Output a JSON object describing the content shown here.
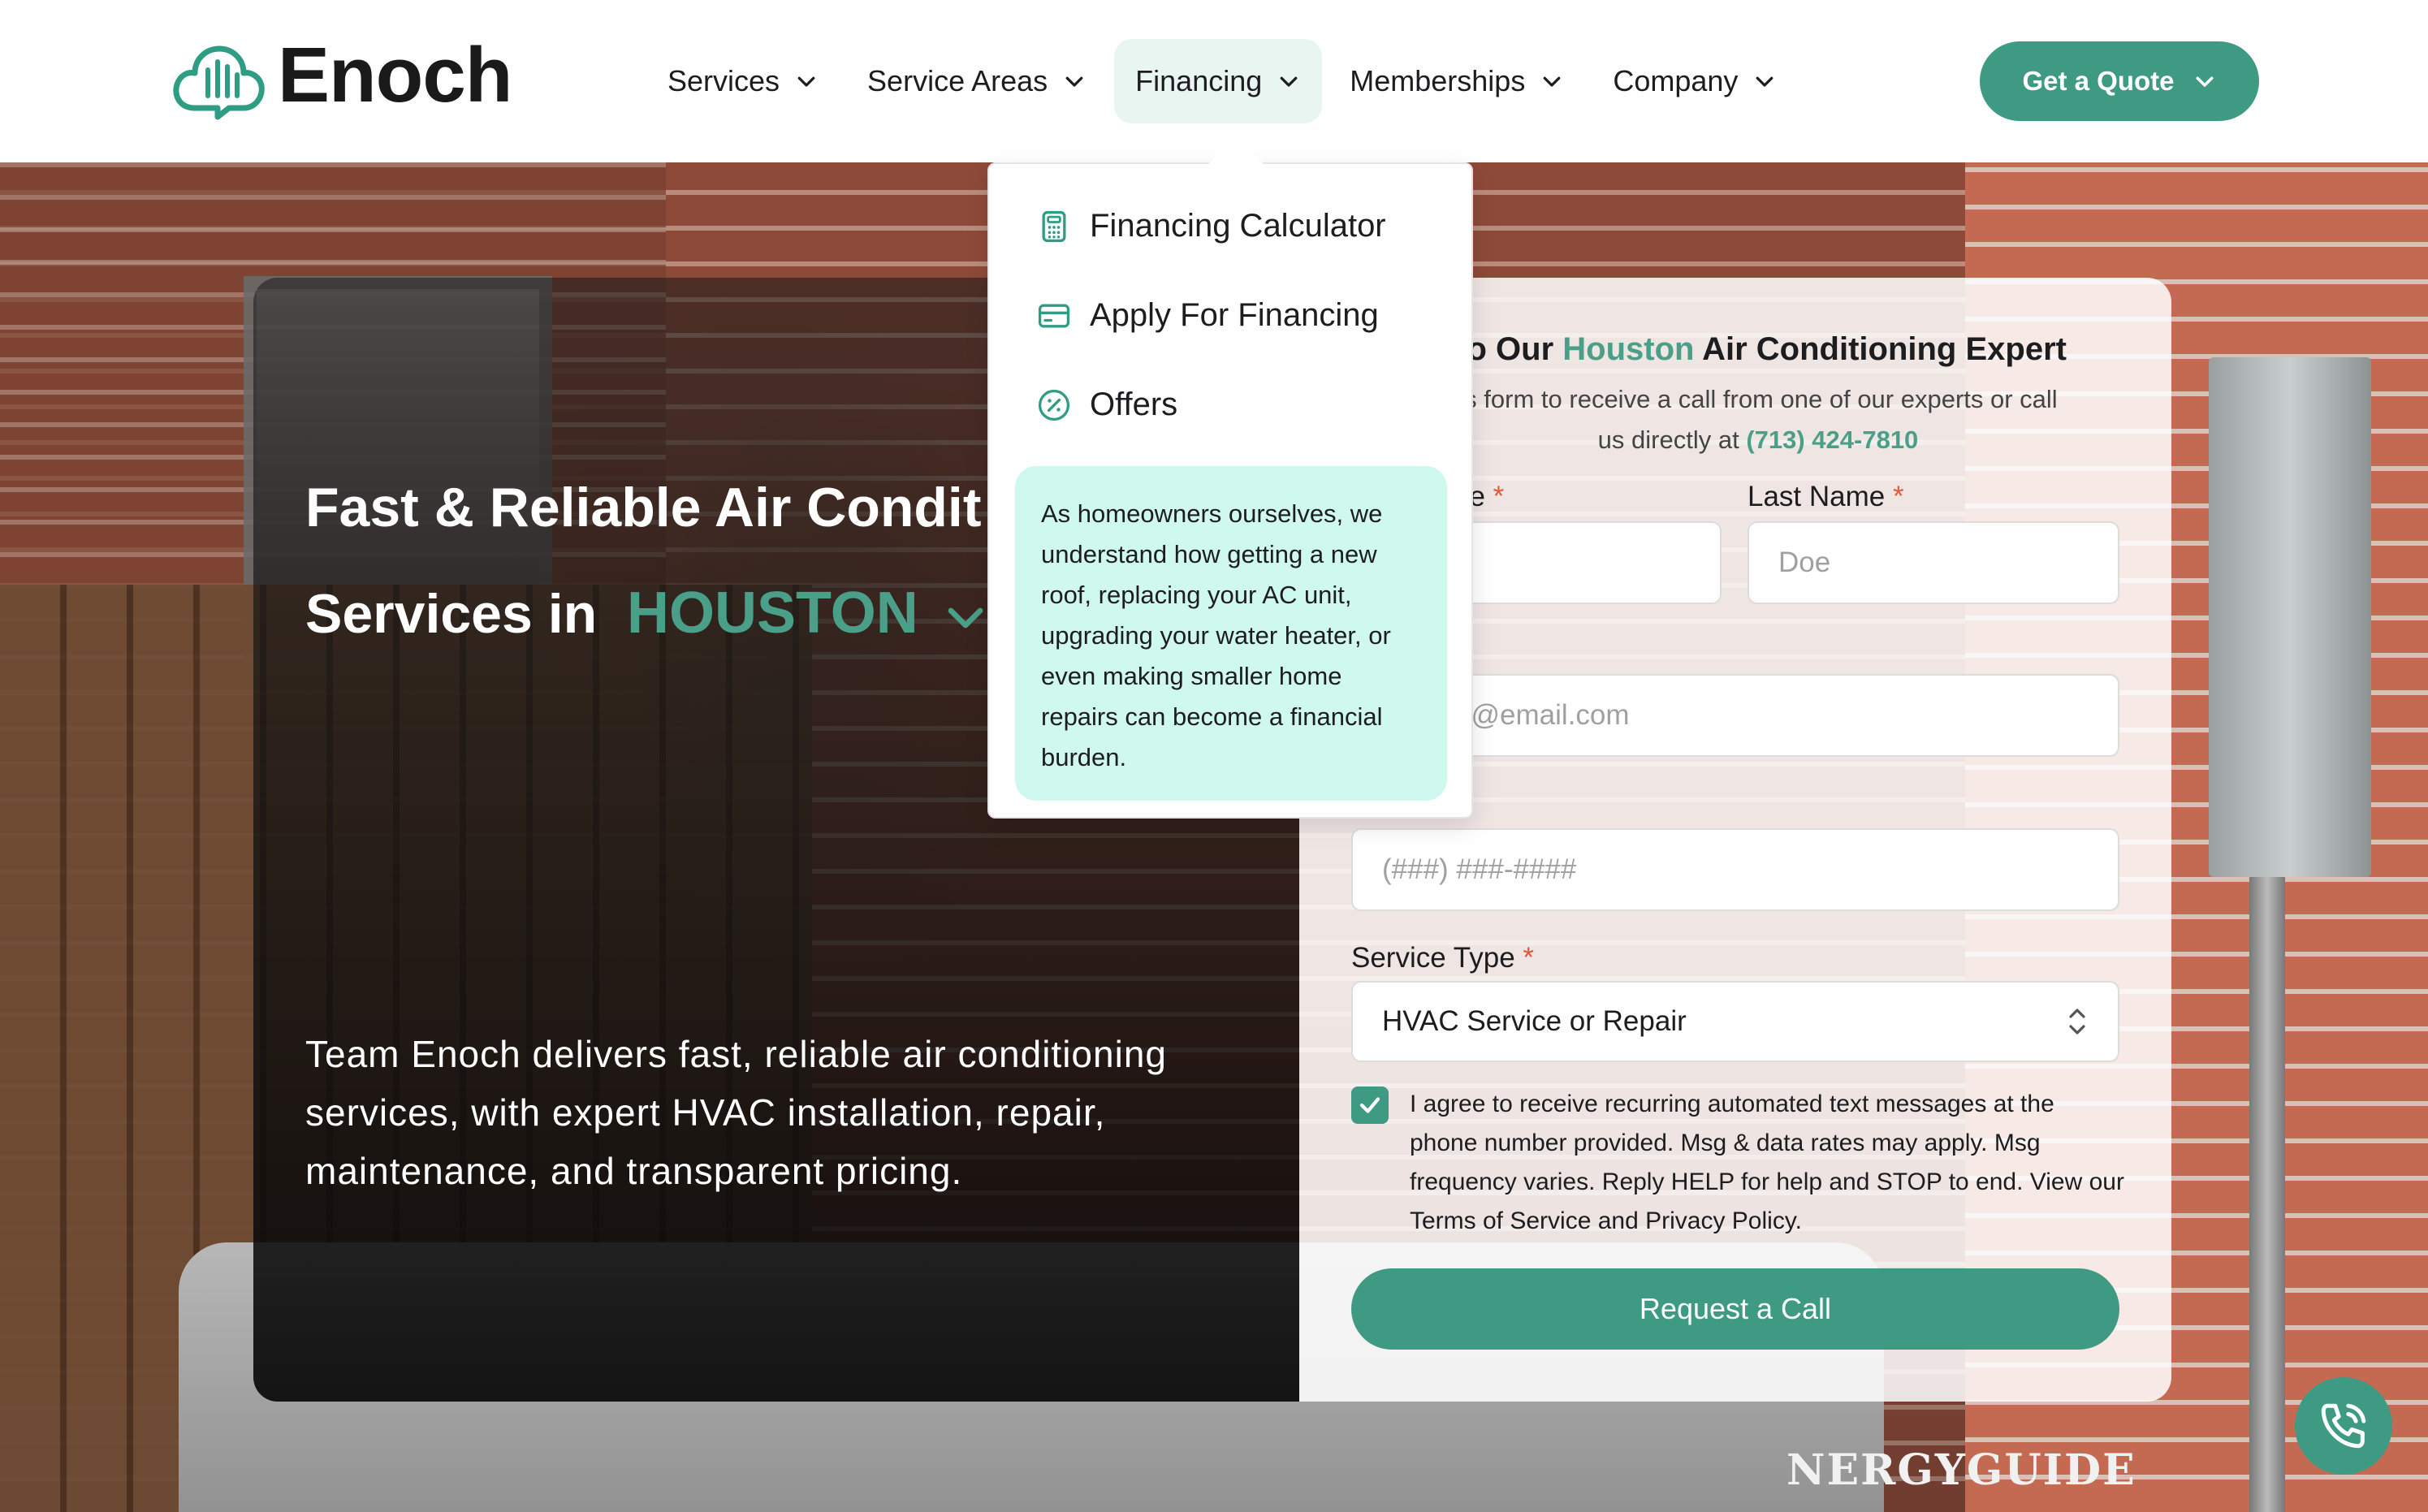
{
  "brand": {
    "name": "Enoch",
    "accent": "#3f9a84"
  },
  "nav": {
    "items": [
      {
        "label": "Services"
      },
      {
        "label": "Service Areas"
      },
      {
        "label": "Financing"
      },
      {
        "label": "Memberships"
      },
      {
        "label": "Company"
      }
    ],
    "cta_label": "Get a Quote"
  },
  "financing_menu": {
    "items": [
      {
        "label": "Financing Calculator",
        "icon": "calculator-icon"
      },
      {
        "label": "Apply For Financing",
        "icon": "credit-card-icon"
      },
      {
        "label": "Offers",
        "icon": "percent-badge-icon"
      }
    ],
    "note": "As homeowners ourselves, we understand how getting a new roof, replacing your AC unit, upgrading your water heater, or even making smaller home repairs can become a financial burden."
  },
  "hero": {
    "title_line1": "Fast & Reliable Air Condit",
    "title_line2_prefix": "Services in",
    "city": "HOUSTON",
    "description": "Team Enoch delivers fast, reliable air conditioning services, with expert HVAC installation, repair, maintenance, and transparent pricing."
  },
  "form": {
    "title_prefix": "To Our",
    "title_accent": "Houston",
    "title_suffix": "Air Conditioning Expert",
    "subtitle_line1": "is form to receive a call from one of our experts or call",
    "subtitle_line2_prefix": "us directly at",
    "phone": "(713) 424-7810",
    "first_name_label": "ne",
    "last_name_label": "Last Name",
    "required_mark": "*",
    "last_name_placeholder": "Doe",
    "email_placeholder": "e@email.com",
    "phone_placeholder": "(###) ###-####",
    "service_type_label": "Service Type",
    "service_type_value": "HVAC Service or Repair",
    "consent_checked": true,
    "consent_text": "I agree to receive recurring automated text messages at the phone number provided. Msg & data rates may apply. Msg frequency varies. Reply HELP for help and STOP to end. View our Terms of Service and Privacy Policy.",
    "submit_label": "Request a Call"
  },
  "background": {
    "energy_label": "NERGYGUIDE"
  }
}
